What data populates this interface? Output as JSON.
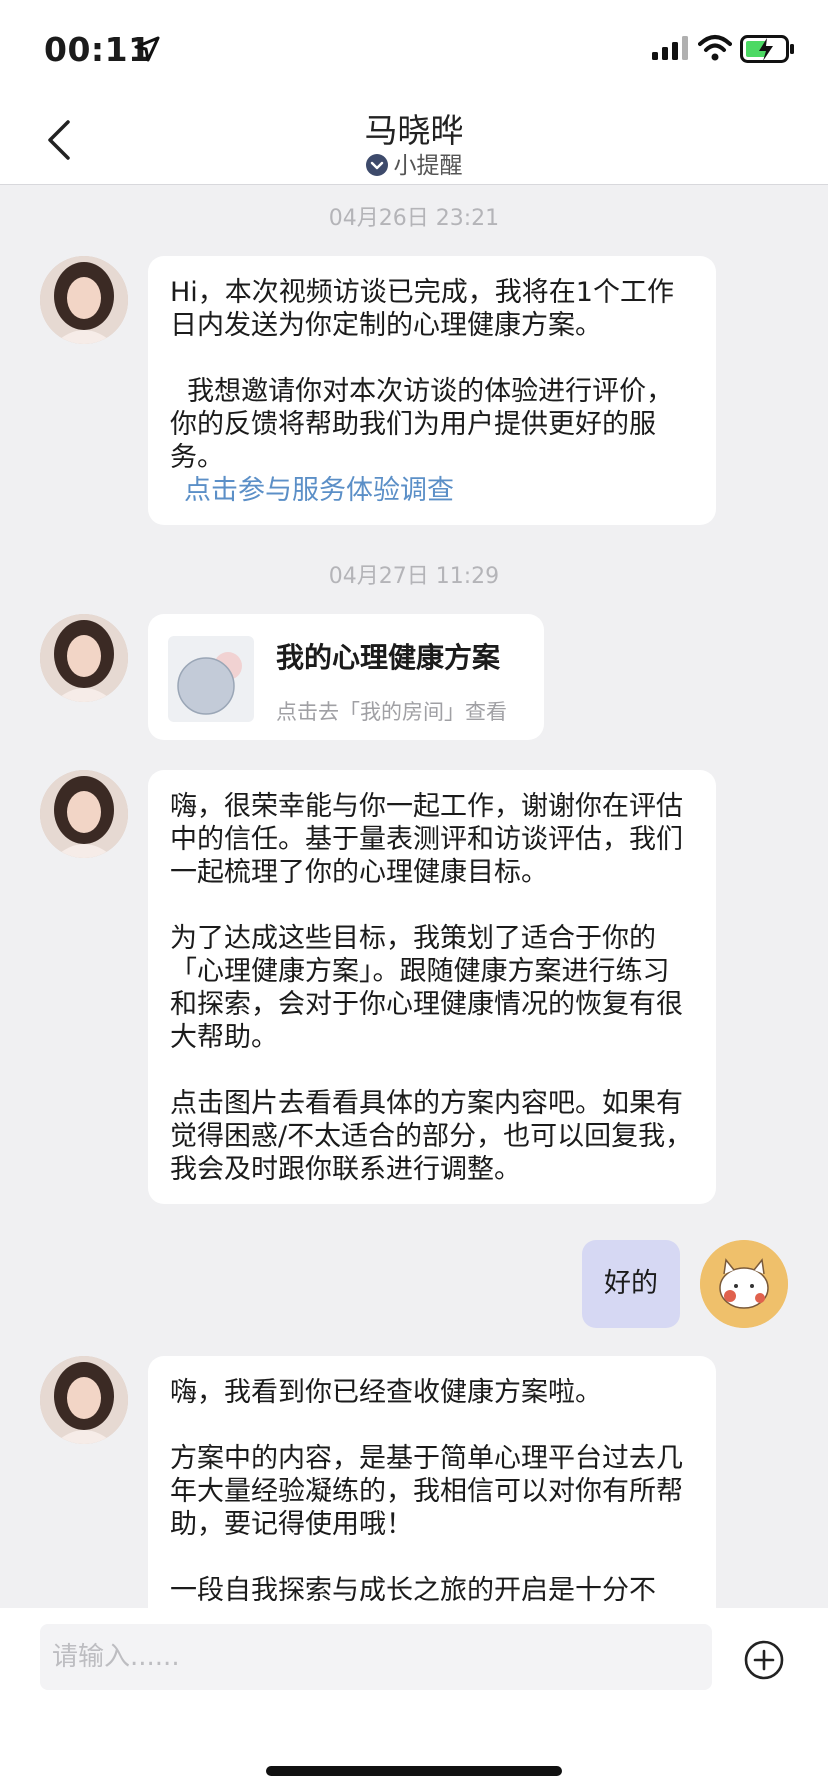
{
  "status_bar": {
    "time": "00:11"
  },
  "header": {
    "title": "马晓晔",
    "subtitle": "小提醒"
  },
  "messages": {
    "ts1": "04月26日 23:21",
    "msg1_p1": "Hi，本次视频访谈已完成，我将在1个工作日内发送为你定制的心理健康方案。",
    "msg1_p2": "  我想邀请你对本次访谈的体验进行评价，你的反馈将帮助我们为用户提供更好的服务。",
    "msg1_link": "点击参与服务体验调查",
    "ts2": "04月27日 11:29",
    "card_title": "我的心理健康方案",
    "card_sub": "点击去「我的房间」查看",
    "msg3_p1": "嗨，很荣幸能与你一起工作，谢谢你在评估中的信任。基于量表测评和访谈评估，我们一起梳理了你的心理健康目标。",
    "msg3_p2": "为了达成这些目标，我策划了适合于你的「心理健康方案」。跟随健康方案进行练习和探索，会对于你心理健康情况的恢复有很大帮助。",
    "msg3_p3": "点击图片去看看具体的方案内容吧。如果有觉得困惑/不太适合的部分，也可以回复我，我会及时跟你联系进行调整。",
    "my_reply": "好的",
    "msg4_p1": "嗨，我看到你已经查收健康方案啦。",
    "msg4_p2": "方案中的内容，是基于简单心理平台过去几年大量经验凝练的，我相信可以对你有所帮助，要记得使用哦！",
    "msg4_p3": "一段自我探索与成长之旅的开启是十分不"
  },
  "input": {
    "placeholder": "请输入......"
  },
  "colors": {
    "my_bubble": "#d6d8f3",
    "link": "#5b8fc7",
    "background": "#f0f0f2"
  },
  "icons": [
    "location-arrow-icon",
    "signal-icon",
    "wifi-icon",
    "battery-charging-icon",
    "back-chevron-icon",
    "verified-check-icon",
    "plus-circle-icon"
  ]
}
